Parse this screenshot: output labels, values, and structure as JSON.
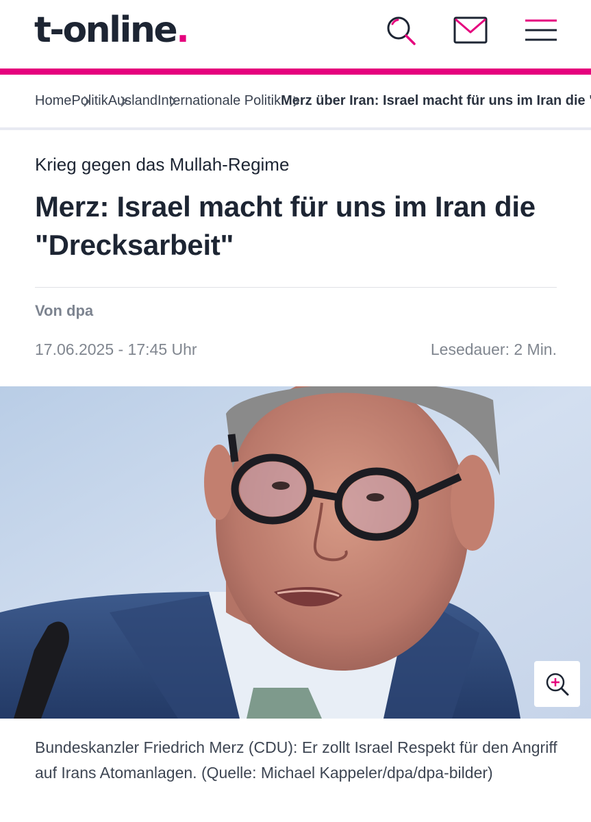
{
  "header": {
    "logo_text": "t-online",
    "logo_dot": ".",
    "icons": [
      "search-icon",
      "mail-icon",
      "menu-icon"
    ],
    "accent_color": "#e5007d"
  },
  "breadcrumb": {
    "items": [
      "Home",
      "Politik",
      "Ausland",
      "Internationale Politik"
    ],
    "current": "Merz über Iran: Israel macht für uns im Iran die \"Drecksarbeit\""
  },
  "article": {
    "kicker": "Krieg gegen das Mullah-Regime",
    "headline": "Merz: Israel macht für uns im Iran die \"Drecksarbeit\"",
    "author": "Von dpa",
    "date": "17.06.2025 - 17:45 Uhr",
    "read_time": "Lesedauer: 2 Min.",
    "image_caption": "Bundeskanzler Friedrich Merz (CDU): Er zollt Israel Respekt für den Angriff auf Irans Atomanlagen. (Quelle: Michael Kappeler/dpa/dpa-bilder)"
  }
}
